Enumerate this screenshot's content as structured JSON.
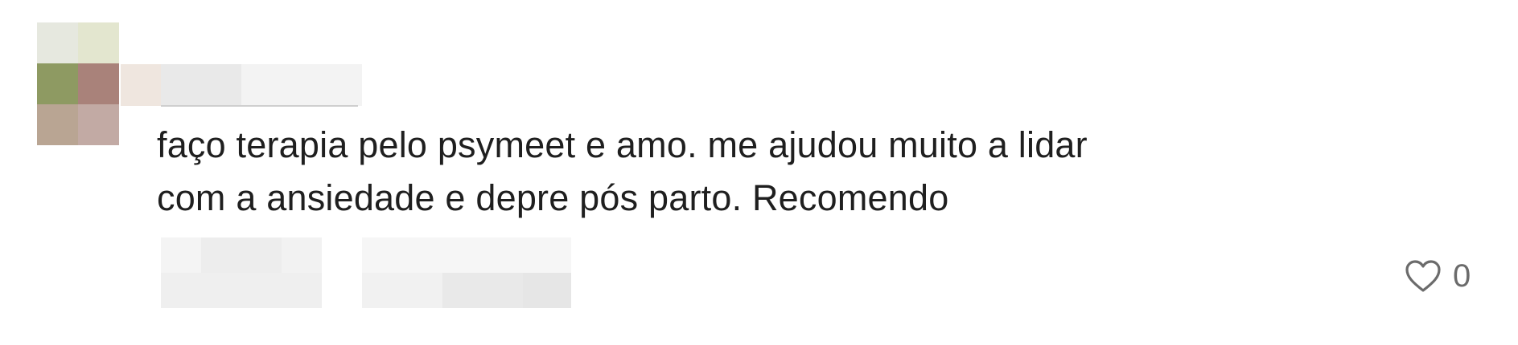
{
  "comment": {
    "text_lines": [
      "faço terapia pelo psymeet e amo. me ajudou muito a lidar",
      "com a ansiedade e depre pós parto. Recomendo"
    ],
    "like_count": "0",
    "like_icon": "heart-outline-icon"
  },
  "colors": {
    "text": "#1f1f1f",
    "muted": "#6b6b6b",
    "avatar_pixels": [
      "#e6e8df",
      "#e3e6cf",
      "#8e9a62",
      "#a9827a",
      "#b9a593",
      "#c2aaa4"
    ]
  }
}
